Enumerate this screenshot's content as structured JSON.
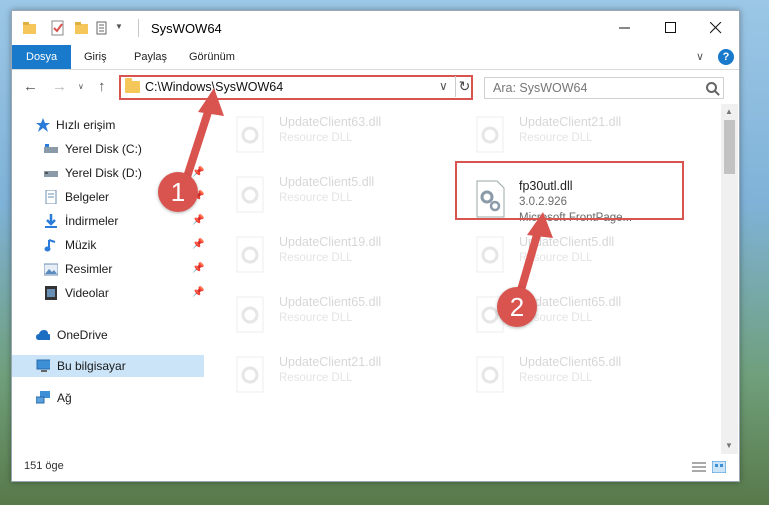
{
  "window": {
    "title": "SysWOW64",
    "ribbon_tabs": [
      "Dosya",
      "Giriş",
      "Paylaş",
      "Görünüm"
    ],
    "help": "?"
  },
  "address": {
    "path": "C:\\Windows\\SysWOW64",
    "search_placeholder": "Ara: SysWOW64"
  },
  "sidebar": {
    "items": [
      {
        "label": "Hızlı erişim",
        "icon": "star-icon"
      },
      {
        "label": "Yerel Disk (C:)",
        "icon": "drive-icon"
      },
      {
        "label": "Yerel Disk (D:)",
        "icon": "drive-icon"
      },
      {
        "label": "Belgeler",
        "icon": "documents-icon"
      },
      {
        "label": "İndirmeler",
        "icon": "download-icon"
      },
      {
        "label": "Müzik",
        "icon": "music-icon"
      },
      {
        "label": "Resimler",
        "icon": "pictures-icon"
      },
      {
        "label": "Videolar",
        "icon": "video-icon"
      },
      {
        "label": "OneDrive",
        "icon": "cloud-icon"
      },
      {
        "label": "Bu bilgisayar",
        "icon": "computer-icon"
      },
      {
        "label": "Ağ",
        "icon": "network-icon"
      }
    ]
  },
  "files": {
    "left": [
      {
        "name": "UpdateClient63.dll",
        "desc": "Resource DLL"
      },
      {
        "name": "UpdateClient5.dll",
        "desc": "Resource DLL"
      },
      {
        "name": "UpdateClient19.dll",
        "desc": "Resource DLL"
      },
      {
        "name": "UpdateClient65.dll",
        "desc": "Resource DLL"
      },
      {
        "name": "UpdateClient21.dll",
        "desc": "Resource DLL"
      }
    ],
    "right": [
      {
        "name": "UpdateClient21.dll",
        "desc": "Resource DLL"
      },
      {
        "name": "fp30utl.dll",
        "desc": "3.0.2.926",
        "desc2": "Microsoft FrontPage..."
      },
      {
        "name": "UpdateClient5.dll",
        "desc": "Resource DLL"
      },
      {
        "name": "UpdateClient65.dll",
        "desc": "Resource DLL"
      },
      {
        "name": "UpdateClient65.dll",
        "desc": "Resource DLL"
      }
    ]
  },
  "status": {
    "count": "151 öge"
  },
  "annotations": {
    "step1": "1",
    "step2": "2",
    "color": "#d9534f"
  }
}
